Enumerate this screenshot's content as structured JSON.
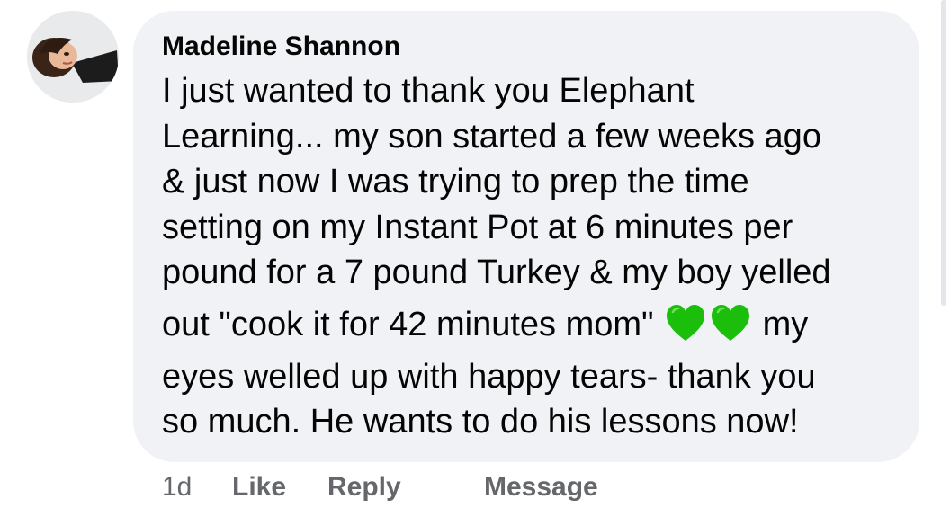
{
  "comment": {
    "author": "Madeline Shannon",
    "text_lines": [
      "I just wanted to thank you Elephant",
      "Learning... my son started a few weeks ago",
      "& just now I was trying to prep the time",
      "setting on my Instant Pot at 6 minutes per",
      "pound for a 7 pound Turkey & my boy yelled",
      "out \"cook it for 42 minutes mom\"",
      "my",
      "eyes welled up with happy tears- thank you",
      "so much. He wants to do his lessons now!"
    ],
    "emoji": "green-heart-icon",
    "emoji_color": "#1bbf0b",
    "bubble_color": "#f0f2f5"
  },
  "actions": {
    "time": "1d",
    "like": "Like",
    "reply": "Reply",
    "message": "Message"
  }
}
